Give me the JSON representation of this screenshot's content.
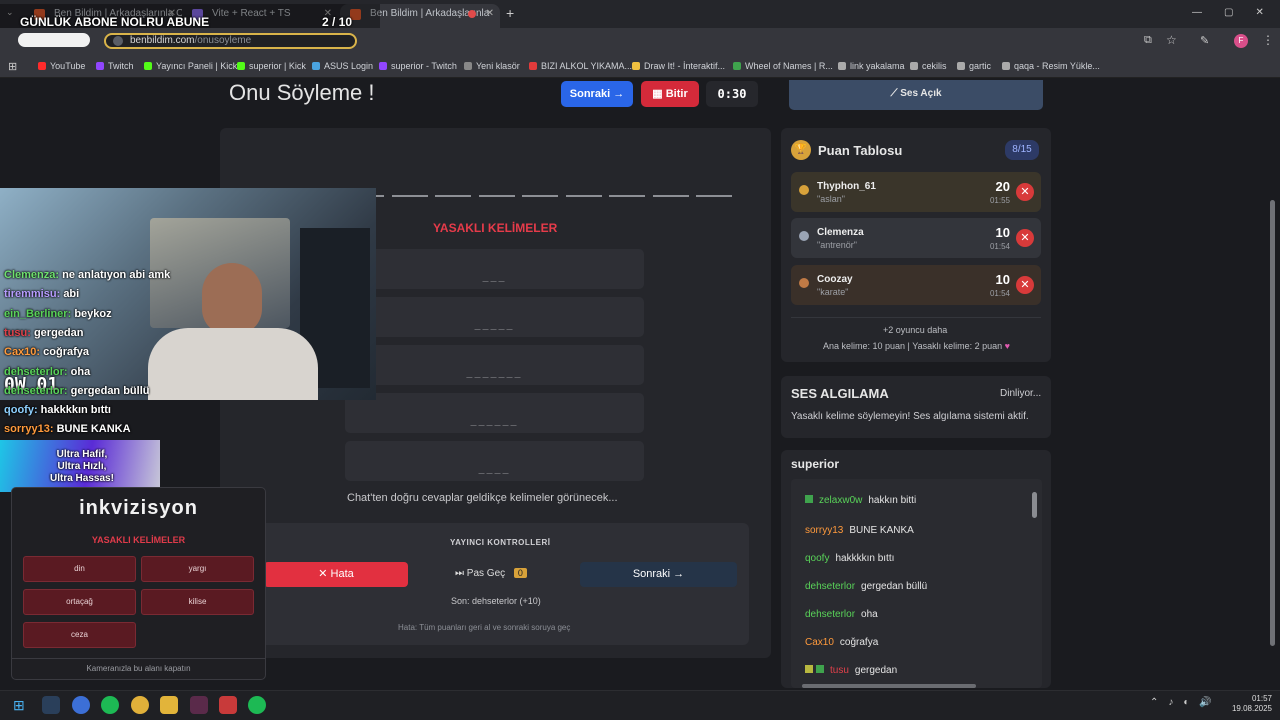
{
  "browser": {
    "tabs": [
      {
        "label": "Ben Bildim | Arkadaşlarınla Oy..."
      },
      {
        "label": "Vite + React + TS"
      },
      {
        "label": "Ben Bildim | Arkadaşlarınla"
      }
    ],
    "url_domain": "benbildim.com",
    "url_path": "/onusoyleme",
    "bookmarks": [
      {
        "label": "YouTube",
        "color": "#ff2b2b"
      },
      {
        "label": "Twitch",
        "color": "#9146ff"
      },
      {
        "label": "Yayıncı Paneli | Kick",
        "color": "#53fc18"
      },
      {
        "label": "superior | Kick",
        "color": "#53fc18"
      },
      {
        "label": "ASUS Login",
        "color": "#4aa3df"
      },
      {
        "label": "superior - Twitch",
        "color": "#9146ff"
      },
      {
        "label": "Yeni klasör",
        "color": "#888888"
      },
      {
        "label": "BIZI ALKOL YIKAMA...",
        "color": "#e23b3b"
      },
      {
        "label": "Draw It! - İnteraktif...",
        "color": "#f0c040"
      },
      {
        "label": "Wheel of Names | R...",
        "color": "#3fa34d"
      },
      {
        "label": "link yakalama",
        "color": "#aaaaaa"
      },
      {
        "label": "cekilis",
        "color": "#aaaaaa"
      },
      {
        "label": "gartic",
        "color": "#aaaaaa"
      },
      {
        "label": "qaqa - Resim Yükle...",
        "color": "#aaaaaa"
      }
    ]
  },
  "overlay": {
    "top_banner": "GÜNLÜK ABONE NOLRU ABUNE",
    "counter": "2 / 10",
    "cam_text": "0W 01",
    "stream_chat": [
      {
        "user": "Clemenza:",
        "msg": "ne anlatıyon abi amk",
        "color": "#6ee06e"
      },
      {
        "user": "tiremmisu:",
        "msg": "abi",
        "color": "#b79cff"
      },
      {
        "user": "ein_Berliner:",
        "msg": "beykoz",
        "color": "#59d359"
      },
      {
        "user": "tusu:",
        "msg": "gergedan",
        "color": "#e0404a"
      },
      {
        "user": "Cax10:",
        "msg": "coğrafya",
        "color": "#ff9a3c"
      },
      {
        "user": "dehseterlor:",
        "msg": "oha",
        "color": "#59d359"
      },
      {
        "user": "dehseterlor:",
        "msg": "gergedan büllü",
        "color": "#59d359"
      },
      {
        "user": "qoofy:",
        "msg": "hakkkkın bıttı",
        "color": "#8ed1ff"
      },
      {
        "user": "sorryy13:",
        "msg": "BUNE KANKA",
        "color": "#ff9a3c"
      }
    ],
    "ad_text": [
      "Ultra Hafif,",
      "Ultra Hızlı,",
      "Ultra Hassas!"
    ],
    "inkvizisyon": {
      "title": "inkvizisyon",
      "subtitle": "YASAKLI KELİMELER",
      "words": [
        "din",
        "yargı",
        "ortaçağ",
        "kilise",
        "ceza"
      ],
      "footer": "Kameranızla bu alanı kapatın"
    }
  },
  "game": {
    "title": "Onu Söyleme !",
    "next_label": "Sonraki",
    "finish_label": "Bitir",
    "timer": "0:30",
    "forbidden_heading": "YASAKLI KELİMELER",
    "forbidden_masks": [
      "___",
      "_____",
      "_______",
      "______",
      "____"
    ],
    "hint": "Chat'ten doğru cevaplar geldikçe kelimeler görünecek...",
    "controls": {
      "heading": "YAYINCI KONTROLLERİ",
      "error_label": "Hata",
      "pass_label": "Pas Geç",
      "pass_count": "0",
      "next_label": "Sonraki",
      "last": "Son: dehseterlor (+10)",
      "help": "Hata: Tüm puanları geri al ve sonraki soruya geç"
    }
  },
  "sound_button": "Ses Açık",
  "scoreboard": {
    "title": "Puan Tablosu",
    "badge": "8/15",
    "players": [
      {
        "name": "Thyphon_61",
        "word": "\"aslan\"",
        "score": "20",
        "time": "01:55",
        "bg": "#3a352a"
      },
      {
        "name": "Clemenza",
        "word": "\"antrenör\"",
        "score": "10",
        "time": "01:54",
        "bg": "#33353b"
      },
      {
        "name": "Coozay",
        "word": "\"karate\"",
        "score": "10",
        "time": "01:54",
        "bg": "#3a3029"
      }
    ],
    "more": "+2 oyuncu daha",
    "rules": "Ana kelime: 10 puan | Yasaklı kelime: 2 puan"
  },
  "voice": {
    "title": "SES ALGILAMA",
    "status": "Dinliyor...",
    "desc": "Yasaklı kelime söylemeyin! Ses algılama sistemi aktif."
  },
  "chat": {
    "title": "superior",
    "messages": [
      {
        "user": "zelaxw0w",
        "msg": "hakkın bitti",
        "color": "#59d359"
      },
      {
        "user": "sorryy13",
        "msg": "BUNE KANKA",
        "color": "#ff9a3c"
      },
      {
        "user": "qoofy",
        "msg": "hakkkkın bıttı",
        "color": "#59d359"
      },
      {
        "user": "dehseterlor",
        "msg": "gergedan büllü",
        "color": "#59d359"
      },
      {
        "user": "dehseterlor",
        "msg": "oha",
        "color": "#59d359"
      },
      {
        "user": "Cax10",
        "msg": "coğrafya",
        "color": "#ff9a3c"
      },
      {
        "user": "tusu",
        "msg": "gergedan",
        "color": "#e0404a"
      }
    ]
  },
  "taskbar": {
    "time": "01:57",
    "date": "19.08.2025"
  }
}
